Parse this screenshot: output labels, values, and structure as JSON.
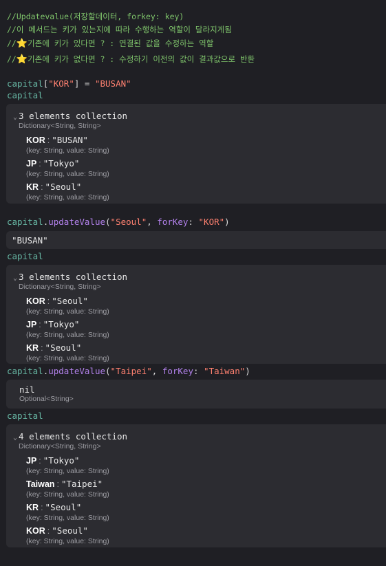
{
  "comments": [
    "//Updatevalue(저장할데이터, forkey: key)",
    "//이 메서드는 키가 있는지에 따라 수행하는 역할이 달라지게됨",
    "기존에 키가 있다면 ? : 연결된 값을 수정하는 역할",
    "기존에 키가 없다면 ? : 수정하기 이전의 값이 결과값으로 반환"
  ],
  "comment_prefix": "//",
  "star_icon": "⭐",
  "code": {
    "assign": {
      "var": "capital",
      "open": "[",
      "key": "\"KOR\"",
      "close": "] = ",
      "value": "\"BUSAN\""
    },
    "var_name": "capital",
    "update1": {
      "var": "capital",
      "dot": ".",
      "method": "updateValue",
      "open": "(",
      "arg1": "\"Seoul\"",
      "sep": ", ",
      "label": "forKey",
      "colon": ": ",
      "arg2": "\"KOR\"",
      "close": ")"
    },
    "update2": {
      "var": "capital",
      "dot": ".",
      "method": "updateValue",
      "open": "(",
      "arg1": "\"Taipei\"",
      "sep": ", ",
      "label": "forKey",
      "colon": ": ",
      "arg2": "\"Taiwan\"",
      "close": ")"
    }
  },
  "results": {
    "collection1": {
      "title": "3 elements collection",
      "type": "Dictionary<String, String>",
      "entries": [
        {
          "key": "KOR",
          "value": "\"BUSAN\"",
          "type": "(key: String, value: String)"
        },
        {
          "key": "JP",
          "value": "\"Tokyo\"",
          "type": "(key: String, value: String)"
        },
        {
          "key": "KR",
          "value": "\"Seoul\"",
          "type": "(key: String, value: String)"
        }
      ]
    },
    "update1_result": "\"BUSAN\"",
    "collection2": {
      "title": "3 elements collection",
      "type": "Dictionary<String, String>",
      "entries": [
        {
          "key": "KOR",
          "value": "\"Seoul\"",
          "type": "(key: String, value: String)"
        },
        {
          "key": "JP",
          "value": "\"Tokyo\"",
          "type": "(key: String, value: String)"
        },
        {
          "key": "KR",
          "value": "\"Seoul\"",
          "type": "(key: String, value: String)"
        }
      ]
    },
    "update2_result": {
      "value": "nil",
      "type": "Optional<String>"
    },
    "collection3": {
      "title": "4 elements collection",
      "type": "Dictionary<String, String>",
      "entries": [
        {
          "key": "JP",
          "value": "\"Tokyo\"",
          "type": "(key: String, value: String)"
        },
        {
          "key": "Taiwan",
          "value": "\"Taipei\"",
          "type": "(key: String, value: String)"
        },
        {
          "key": "KR",
          "value": "\"Seoul\"",
          "type": "(key: String, value: String)"
        },
        {
          "key": "KOR",
          "value": "\"Seoul\"",
          "type": "(key: String, value: String)"
        }
      ]
    }
  },
  "colors": {
    "background": "#1f1f24",
    "panel": "#2c2c31",
    "comment": "#7fc46b",
    "variable": "#67b7a4",
    "method": "#b281eb",
    "string": "#ff8170"
  }
}
